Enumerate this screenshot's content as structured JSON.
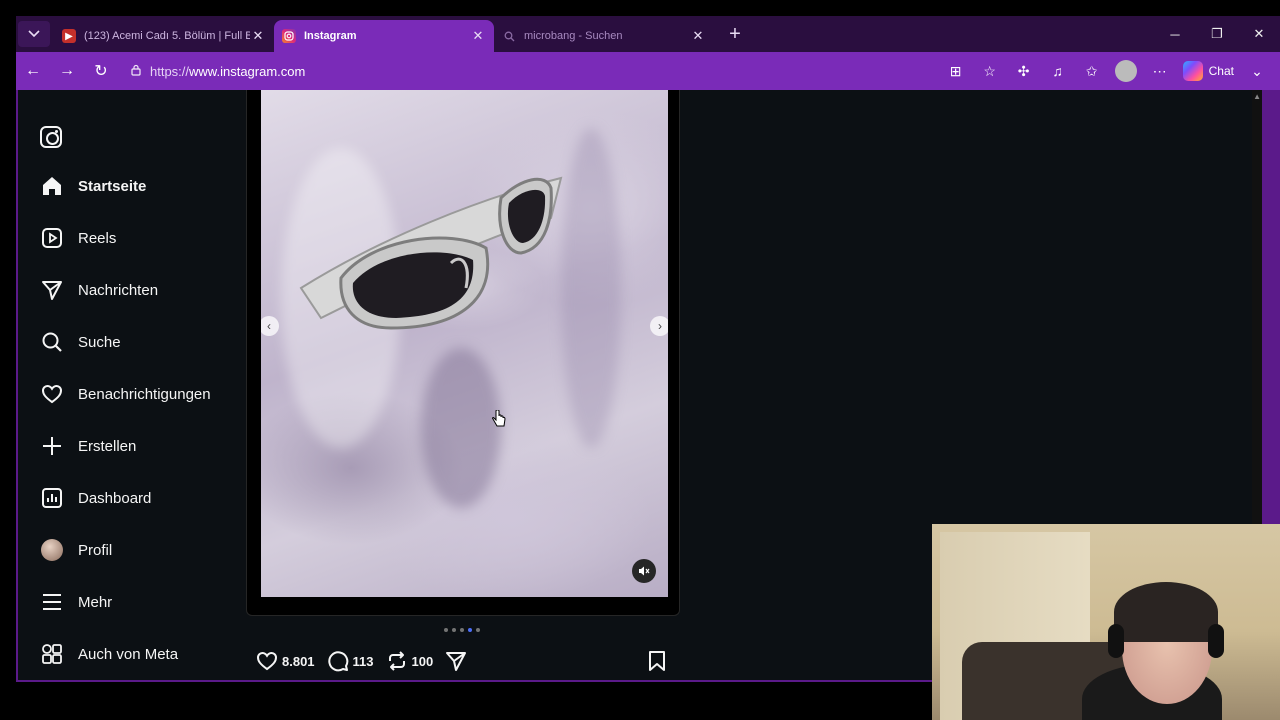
{
  "browser": {
    "tabs": [
      {
        "label": "(123) Acemi Cadı 5. Bölüm | Full Bö",
        "favicon": "youtube-icon",
        "active": false
      },
      {
        "label": "Instagram",
        "favicon": "instagram-icon",
        "active": true
      },
      {
        "label": "microbang - Suchen",
        "favicon": "search-icon",
        "active": false
      }
    ],
    "url_scheme": "https://",
    "url_host": "www.instagram.com",
    "chat_label": "Chat",
    "accent": "#7a2bb8"
  },
  "sidebar": {
    "items": [
      {
        "label": "Startseite",
        "icon": "home-icon",
        "bold": true
      },
      {
        "label": "Reels",
        "icon": "reels-icon"
      },
      {
        "label": "Nachrichten",
        "icon": "messages-icon"
      },
      {
        "label": "Suche",
        "icon": "search-icon"
      },
      {
        "label": "Benachrichtigungen",
        "icon": "heart-icon"
      },
      {
        "label": "Erstellen",
        "icon": "plus-icon"
      },
      {
        "label": "Dashboard",
        "icon": "dashboard-icon"
      },
      {
        "label": "Profil",
        "icon": "profile-avatar"
      },
      {
        "label": "Mehr",
        "icon": "menu-icon"
      },
      {
        "label": "Auch von Meta",
        "icon": "meta-apps-icon"
      }
    ]
  },
  "post": {
    "likes": "8.801",
    "comments": "113",
    "reposts": "100",
    "carousel_dots": 5,
    "active_dot": 3
  }
}
